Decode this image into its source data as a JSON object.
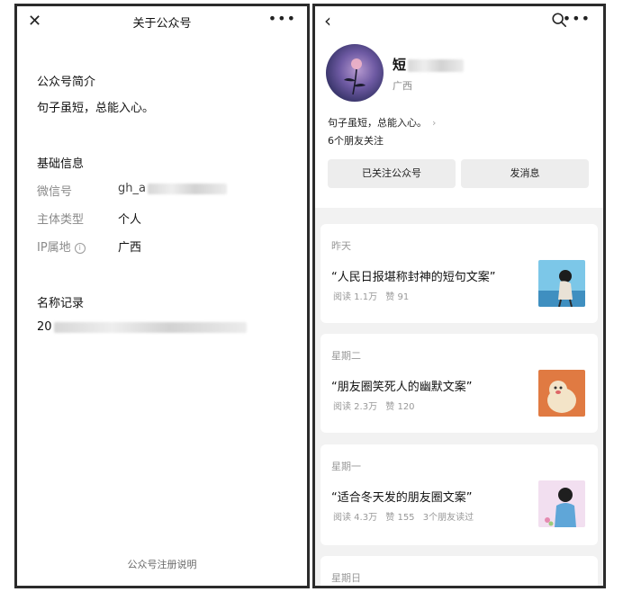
{
  "left_panel": {
    "header": {
      "close_icon": "close-icon",
      "title": "关于公众号",
      "more_icon": "more-icon"
    },
    "intro": {
      "heading": "公众号简介",
      "text": "句子虽短，总能入心。"
    },
    "basic_info": {
      "heading": "基础信息",
      "wechat_id_label": "微信号",
      "wechat_id_value": "gh_a",
      "entity_type_label": "主体类型",
      "entity_type_value": "个人",
      "ip_label": "IP属地",
      "ip_value": "广西"
    },
    "name_history": {
      "heading": "名称记录",
      "value_prefix": "20"
    },
    "footer_link": "公众号注册说明"
  },
  "right_panel": {
    "header": {
      "back_icon": "back-icon",
      "search_icon": "search-icon",
      "more_icon": "more-icon"
    },
    "account": {
      "name_prefix": "短",
      "region": "广西",
      "description": "句子虽短，总能入心。",
      "friends_following": "6个朋友关注"
    },
    "buttons": {
      "follow": "已关注公众号",
      "message": "发消息"
    },
    "articles": [
      {
        "day": "昨天",
        "title": "“人民日报堪称封神的短句文案”",
        "reads": "阅读 1.1万",
        "likes": "赞 91",
        "extra": ""
      },
      {
        "day": "星期二",
        "title": "“朋友圈笑死人的幽默文案”",
        "reads": "阅读 2.3万",
        "likes": "赞 120",
        "extra": ""
      },
      {
        "day": "星期一",
        "title": "“适合冬天发的朋友圈文案”",
        "reads": "阅读 4.3万",
        "likes": "赞 155",
        "extra": "3个朋友读过"
      }
    ],
    "next_day": "星期日"
  }
}
